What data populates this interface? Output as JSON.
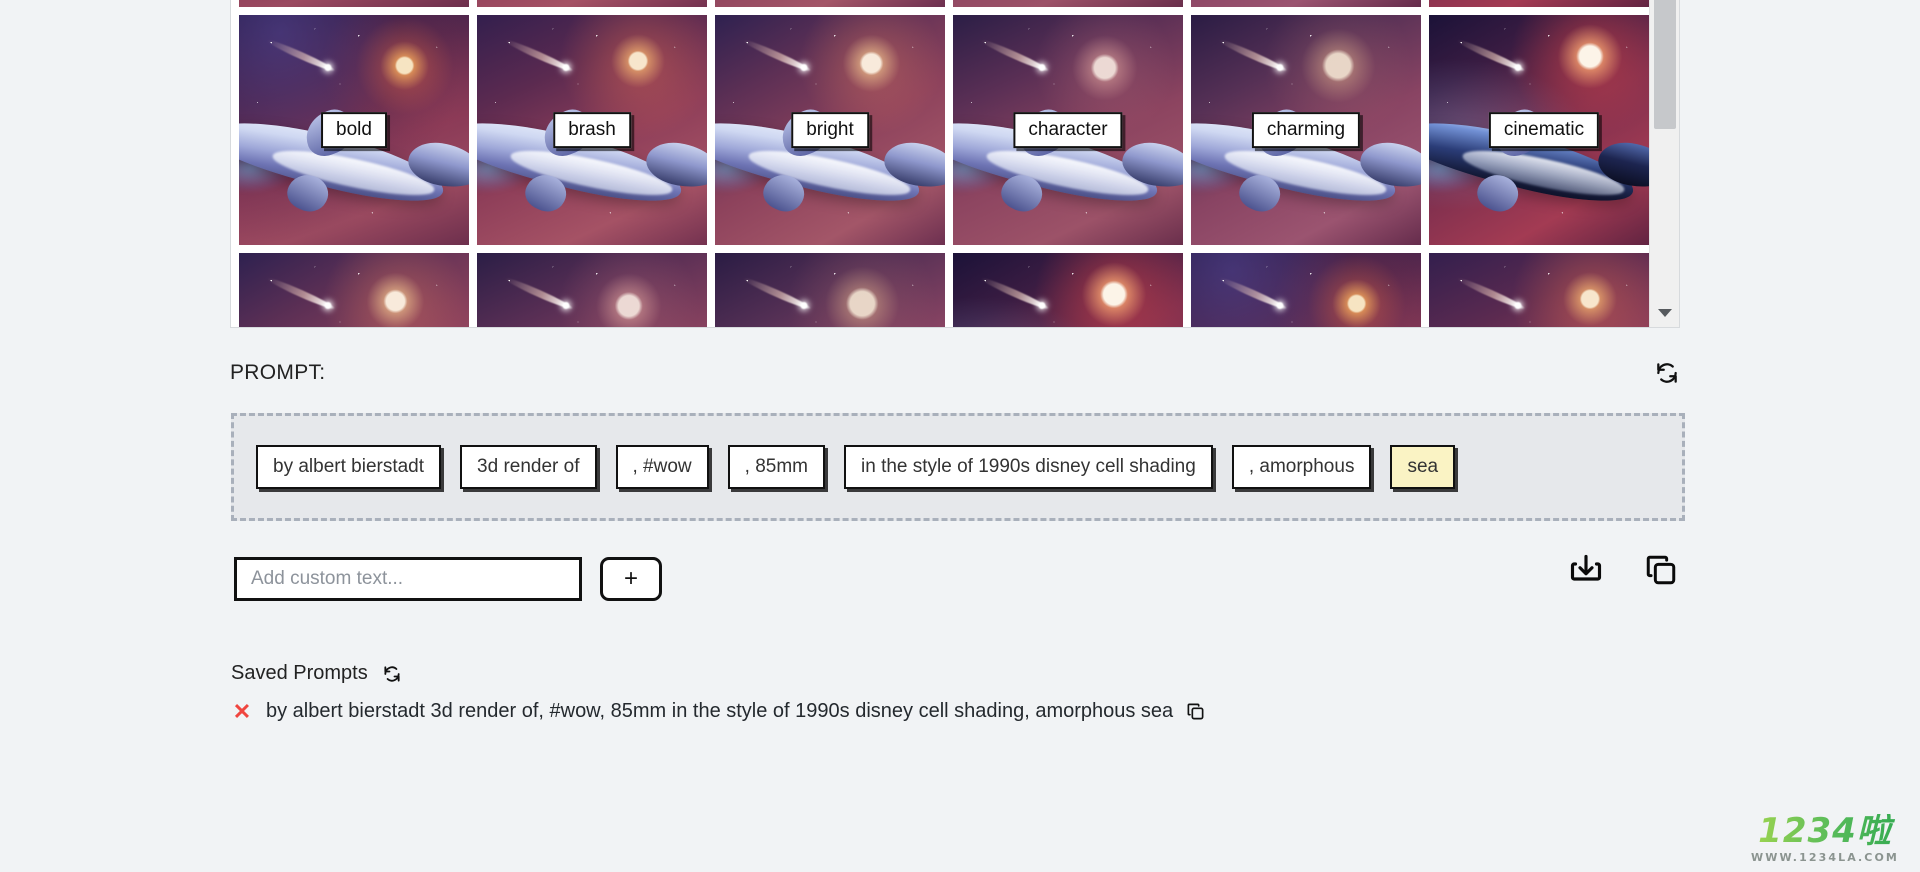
{
  "gallery": {
    "rows": [
      {
        "partial": "top",
        "cells": [
          {
            "label": "",
            "variant": "v1",
            "selected": false
          },
          {
            "label": "",
            "variant": "v2",
            "selected": false
          },
          {
            "label": "",
            "variant": "v3",
            "selected": false
          },
          {
            "label": "",
            "variant": "v4",
            "selected": false
          },
          {
            "label": "",
            "variant": "v5",
            "selected": true
          },
          {
            "label": "",
            "variant": "v6",
            "selected": false
          }
        ]
      },
      {
        "partial": "none",
        "cells": [
          {
            "label": "bold",
            "variant": "v1",
            "selected": false
          },
          {
            "label": "brash",
            "variant": "v2",
            "selected": false
          },
          {
            "label": "bright",
            "variant": "v3",
            "selected": false
          },
          {
            "label": "character",
            "variant": "v4",
            "selected": false
          },
          {
            "label": "charming",
            "variant": "v5",
            "selected": false
          },
          {
            "label": "cinematic",
            "variant": "v6",
            "selected": false
          }
        ]
      },
      {
        "partial": "bottom",
        "cells": [
          {
            "label": "",
            "variant": "v3",
            "selected": false
          },
          {
            "label": "",
            "variant": "v4",
            "selected": false
          },
          {
            "label": "",
            "variant": "v5",
            "selected": false
          },
          {
            "label": "",
            "variant": "v6",
            "selected": false
          },
          {
            "label": "",
            "variant": "v1",
            "selected": false
          },
          {
            "label": "",
            "variant": "v2",
            "selected": false
          }
        ]
      }
    ],
    "scrollbar": {
      "arrow_down": "▼"
    }
  },
  "prompt": {
    "title": "PROMPT:",
    "shuffle_icon": "refresh-icon",
    "chips": [
      {
        "label": "by albert bierstadt",
        "highlight": false
      },
      {
        "label": "3d render of",
        "highlight": false
      },
      {
        "label": ", #wow",
        "highlight": false
      },
      {
        "label": ", 85mm",
        "highlight": false
      },
      {
        "label": "in the style of 1990s disney cell shading",
        "highlight": false
      },
      {
        "label": ", amorphous",
        "highlight": false
      },
      {
        "label": "sea",
        "highlight": true
      }
    ],
    "highlight_color": "#faf3c4"
  },
  "input_row": {
    "placeholder": "Add custom text...",
    "value": "",
    "add_label": "+"
  },
  "actions": {
    "download_icon": "download-icon",
    "copy_icon": "copy-icon"
  },
  "saved_prompts": {
    "heading": "Saved Prompts",
    "refresh_icon": "refresh-icon",
    "items": [
      {
        "remove_label": "✕",
        "text": "by albert bierstadt 3d render of, #wow, 85mm in the style of 1990s disney cell shading, amorphous sea",
        "copy_icon": "copy-icon"
      }
    ]
  },
  "watermark": {
    "main": "1234啦",
    "sub": "WWW.1234LA.COM"
  }
}
